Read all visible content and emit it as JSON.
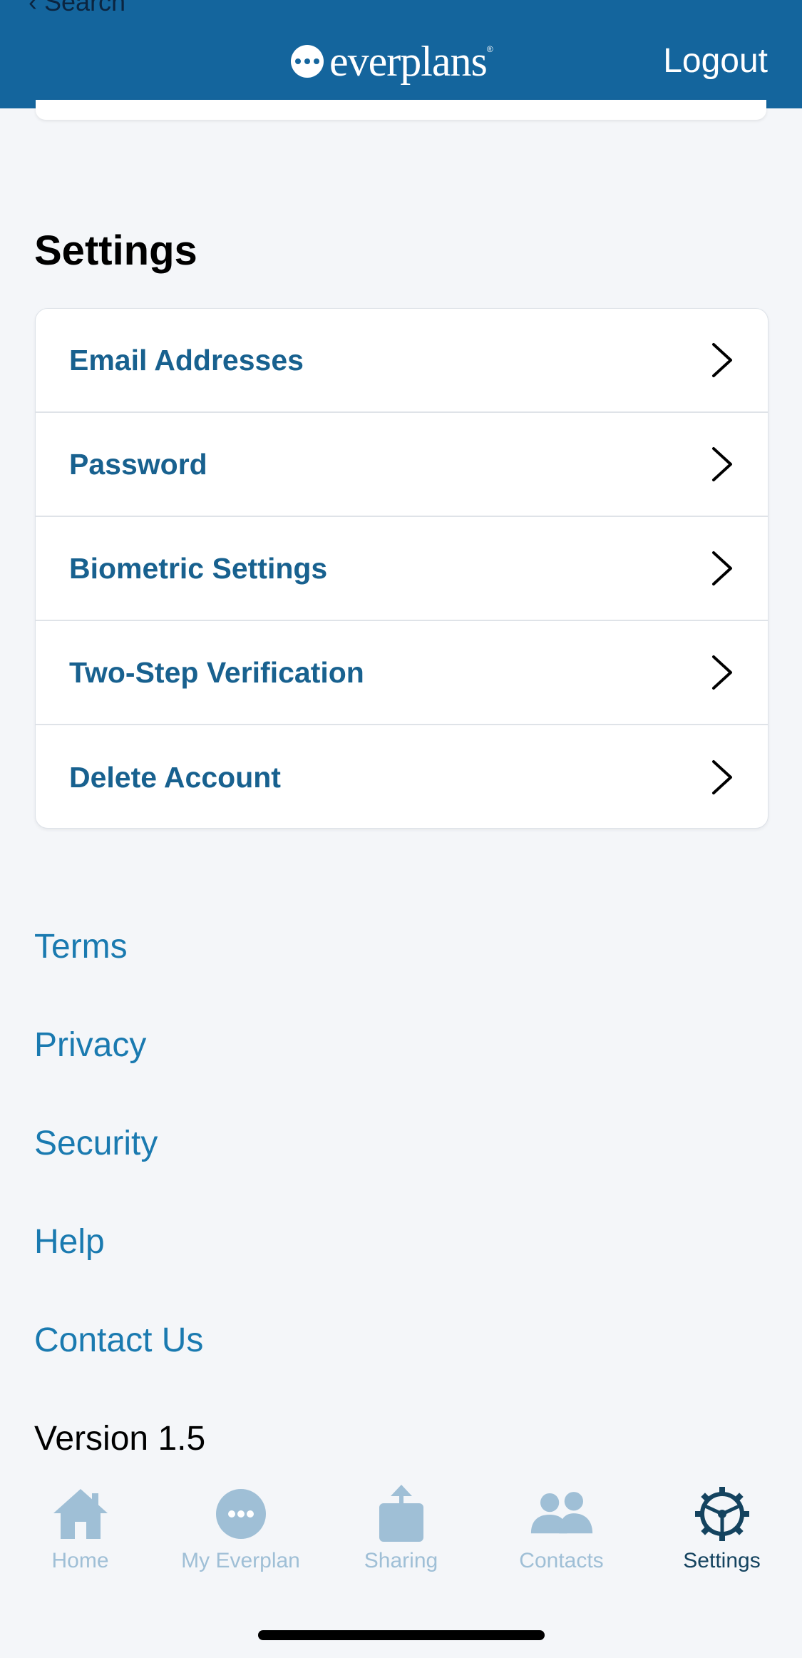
{
  "header": {
    "back_label": "‹ Search",
    "logo_text": "everplans",
    "logo_reg": "®",
    "logout_label": "Logout"
  },
  "settings": {
    "title": "Settings",
    "items": [
      {
        "label": "Email Addresses"
      },
      {
        "label": "Password"
      },
      {
        "label": "Biometric Settings"
      },
      {
        "label": "Two-Step Verification"
      },
      {
        "label": "Delete Account"
      }
    ]
  },
  "links": {
    "terms": "Terms",
    "privacy": "Privacy",
    "security": "Security",
    "help": "Help",
    "contact": "Contact Us"
  },
  "version": "Version 1.5",
  "tabbar": {
    "tabs": [
      {
        "label": "Home",
        "icon": "home-icon"
      },
      {
        "label": "My Everplan",
        "icon": "dots-icon"
      },
      {
        "label": "Sharing",
        "icon": "share-icon"
      },
      {
        "label": "Contacts",
        "icon": "contacts-icon"
      },
      {
        "label": "Settings",
        "icon": "gear-icon",
        "active": true
      }
    ]
  },
  "colors": {
    "brand": "#14659d",
    "link": "#1a7ab0",
    "row_label": "#18618f",
    "tab_inactive": "#9fbfd6",
    "tab_active": "#14435f"
  }
}
